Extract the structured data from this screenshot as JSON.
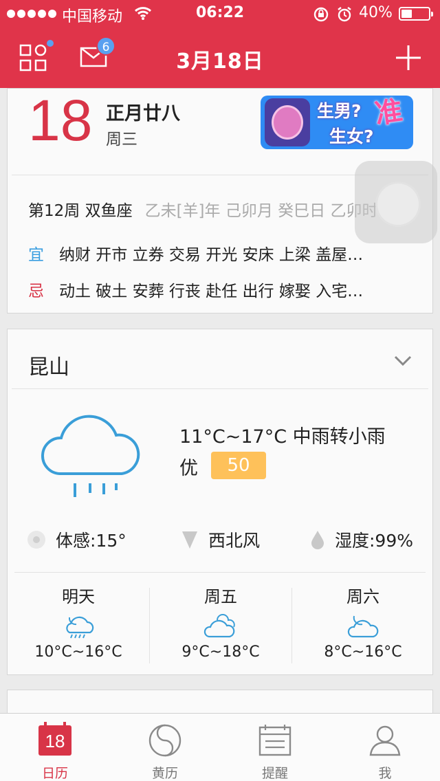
{
  "status_bar": {
    "carrier": "中国移动",
    "time": "06:22",
    "battery_percent": "40%",
    "battery_level": 0.4
  },
  "nav": {
    "title": "3月18日",
    "mail_badge": "6"
  },
  "calendar_card": {
    "day": "18",
    "lunar_date": "正月廿八",
    "weekday": "周三",
    "banner": {
      "line1": "生男?",
      "line2": "生女?",
      "tag": "准"
    },
    "week_info": "第12周 双鱼座",
    "ganzhi": "乙未[羊]年 己卯月 癸巳日 乙卯时",
    "yi_label": "宜",
    "yi_items": "纳财 开市 立券 交易 开光 安床 上梁 盖屋…",
    "ji_label": "忌",
    "ji_items": "动土 破土 安葬 行丧 赴任 出行 嫁娶 入宅…"
  },
  "weather_card": {
    "city": "昆山",
    "temp_desc": "11°C~17°C 中雨转小雨",
    "aqi_label": "优",
    "aqi_value": "50",
    "feels_like": "体感:15°",
    "wind": "西北风",
    "humidity": "湿度:99%",
    "forecast": [
      {
        "day": "明天",
        "range": "10°C~16°C",
        "icon": "night-cloud-rain-icon"
      },
      {
        "day": "周五",
        "range": "9°C~18°C",
        "icon": "cloudy-icon"
      },
      {
        "day": "周六",
        "range": "8°C~16°C",
        "icon": "night-cloudy-icon"
      }
    ]
  },
  "colors": {
    "brand_red": "#e0344a",
    "accent_blue": "#5aa0f0",
    "aqi_yellow": "#fec15a",
    "weather_blue": "#3a9ed8"
  },
  "tabbar": {
    "calendar_icon_text": "18",
    "tabs": [
      {
        "label": "日历",
        "active": true
      },
      {
        "label": "黄历",
        "active": false
      },
      {
        "label": "提醒",
        "active": false
      },
      {
        "label": "我",
        "active": false
      }
    ]
  }
}
